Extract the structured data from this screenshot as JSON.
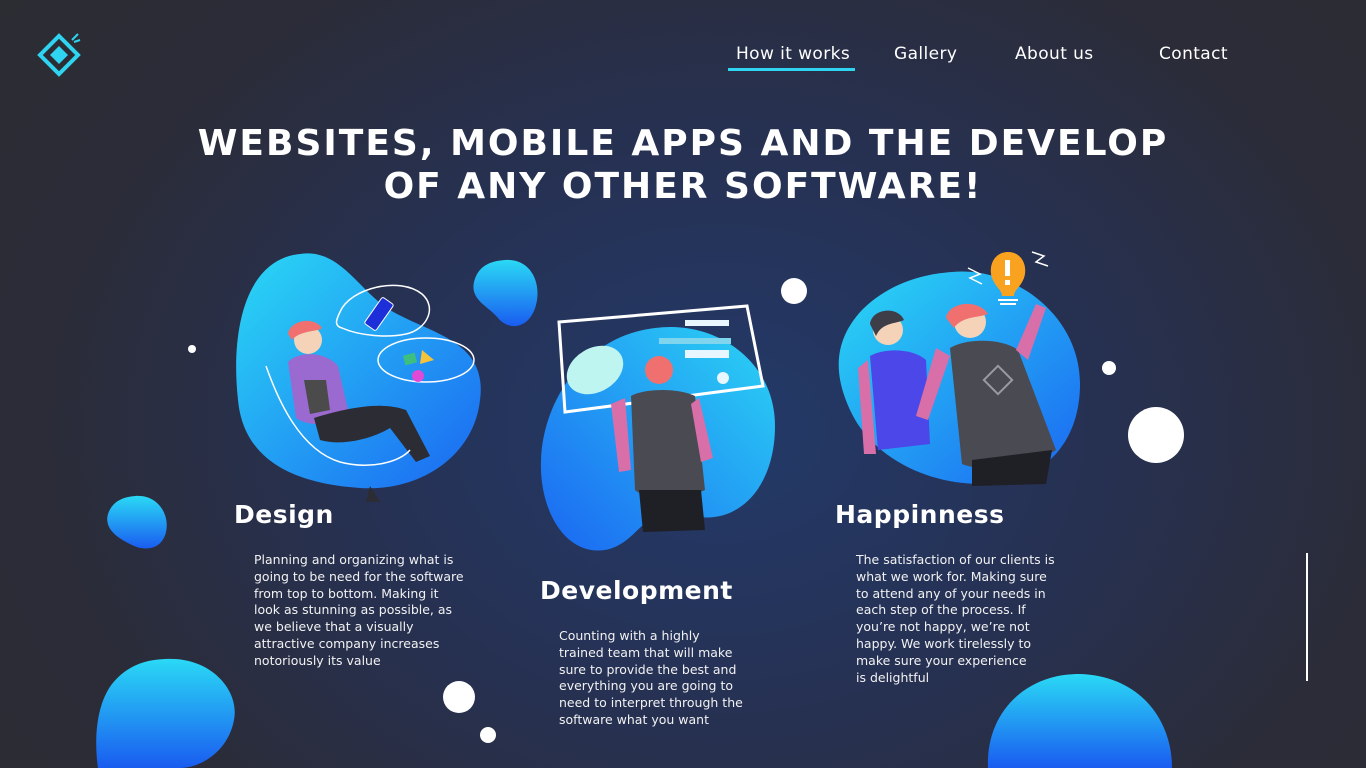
{
  "nav": {
    "items": [
      {
        "label": "How it works"
      },
      {
        "label": "Gallery"
      },
      {
        "label": "About us"
      },
      {
        "label": "Contact"
      }
    ],
    "active": "How it works"
  },
  "hero": {
    "title_line1": "WEBSITES, MOBILE APPS AND THE DEVELOP",
    "title_line2": "OF ANY OTHER SOFTWARE!"
  },
  "features": [
    {
      "title": "Design",
      "lines": [
        "Planning and organizing what is",
        "going to be need for the software",
        "from top to bottom. Making it",
        "look as stunning as possible, as",
        "we believe that a visually",
        "attractive company increases",
        "notoriously its value"
      ]
    },
    {
      "title": "Development",
      "lines": [
        "Counting with a highly",
        "trained team that will make",
        "sure to provide the best and",
        "everything you are going to",
        "need to interpret through the",
        "software what you want"
      ]
    },
    {
      "title": "Happinness",
      "lines": [
        "The satisfaction of our clients is",
        "what we work for. Making sure",
        "to attend any of your needs in",
        "each step of the process. If",
        "you’re not happy, we’re not",
        "happy.  We work tirelessly to",
        "make sure your experience",
        "is delightful"
      ]
    }
  ],
  "colors": {
    "accent": "#2fd4f0",
    "blob_light": "#2ad9f5",
    "blob_dark": "#1a5cf0",
    "text": "#ffffff"
  },
  "icons": {
    "logo": "diamond-logo-icon"
  }
}
